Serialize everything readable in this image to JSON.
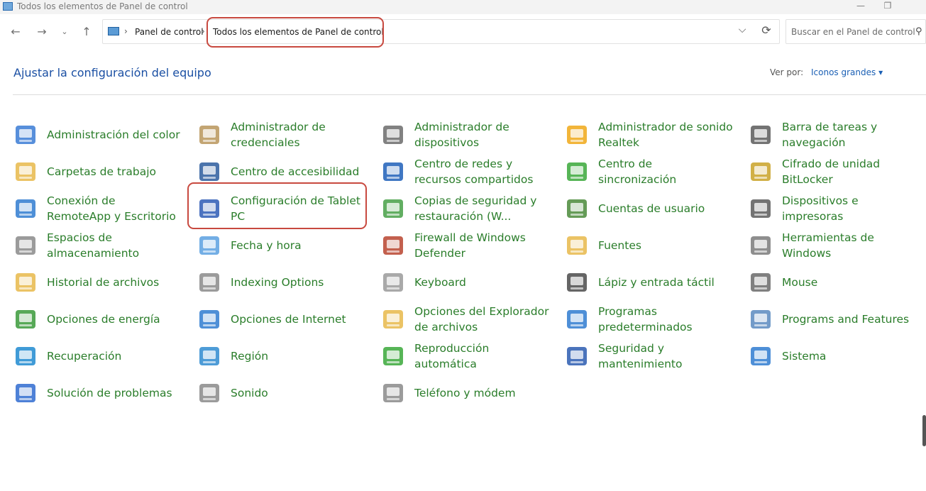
{
  "window": {
    "title": "Todos los elementos de Panel de control"
  },
  "address": {
    "crumbs": [
      "Panel de control",
      "Todos los elementos de Panel de control"
    ],
    "separator": "›"
  },
  "search": {
    "placeholder": "Buscar en el Panel de control"
  },
  "header": {
    "title": "Ajustar la configuración del equipo",
    "view_label": "Ver por:",
    "view_value": "Iconos grandes ▾"
  },
  "items": [
    {
      "label": "Administración del color",
      "icon": "color-management-icon",
      "color": "#3a7bd5"
    },
    {
      "label": "Administrador de credenciales",
      "icon": "credential-manager-icon",
      "color": "#b8955a"
    },
    {
      "label": "Administrador de dispositivos",
      "icon": "device-manager-icon",
      "color": "#6b6b6b"
    },
    {
      "label": "Administrador de sonido Realtek",
      "icon": "realtek-audio-icon",
      "color": "#f0a818"
    },
    {
      "label": "Barra de tareas y navegación",
      "icon": "taskbar-icon",
      "color": "#5a5a5a"
    },
    {
      "label": "Carpetas de trabajo",
      "icon": "work-folders-icon",
      "color": "#e8b84a"
    },
    {
      "label": "Centro de accesibilidad",
      "icon": "accessibility-icon",
      "color": "#2b5c9e"
    },
    {
      "label": "Centro de redes y recursos compartidos",
      "icon": "network-icon",
      "color": "#1f5fb8"
    },
    {
      "label": "Centro de sincronización",
      "icon": "sync-center-icon",
      "color": "#3aa83a"
    },
    {
      "label": "Cifrado de unidad BitLocker",
      "icon": "bitlocker-icon",
      "color": "#c9a227"
    },
    {
      "label": "Conexión de RemoteApp y Escritorio",
      "icon": "remoteapp-icon",
      "color": "#2f7bd0"
    },
    {
      "label": "Configuración de Tablet PC",
      "icon": "tablet-pc-icon",
      "color": "#2d5bb5"
    },
    {
      "label": "Copias de seguridad y restauración (W...",
      "icon": "backup-restore-icon",
      "color": "#47a047"
    },
    {
      "label": "Cuentas de usuario",
      "icon": "user-accounts-icon",
      "color": "#4a8a3a"
    },
    {
      "label": "Dispositivos e impresoras",
      "icon": "printer-icon",
      "color": "#5a5a5a"
    },
    {
      "label": "Espacios de almacenamiento",
      "icon": "storage-spaces-icon",
      "color": "#8a8a8a"
    },
    {
      "label": "Fecha y hora",
      "icon": "date-time-icon",
      "color": "#5aa0e0"
    },
    {
      "label": "Firewall de Windows Defender",
      "icon": "firewall-icon",
      "color": "#b8442f"
    },
    {
      "label": "Fuentes",
      "icon": "fonts-icon",
      "color": "#e8b84a"
    },
    {
      "label": "Herramientas de Windows",
      "icon": "windows-tools-icon",
      "color": "#7a7a7a"
    },
    {
      "label": "Historial de archivos",
      "icon": "file-history-icon",
      "color": "#e8b84a"
    },
    {
      "label": "Indexing Options",
      "icon": "indexing-options-icon",
      "color": "#8a8a8a"
    },
    {
      "label": "Keyboard",
      "icon": "keyboard-icon",
      "color": "#9a9a9a"
    },
    {
      "label": "Lápiz y entrada táctil",
      "icon": "pen-touch-icon",
      "color": "#4a4a4a"
    },
    {
      "label": "Mouse",
      "icon": "mouse-icon",
      "color": "#6a6a6a"
    },
    {
      "label": "Opciones de energía",
      "icon": "power-options-icon",
      "color": "#3a9a3a"
    },
    {
      "label": "Opciones de Internet",
      "icon": "internet-options-icon",
      "color": "#2f7bd0"
    },
    {
      "label": "Opciones del Explorador de archivos",
      "icon": "folder-options-icon",
      "color": "#e8b84a"
    },
    {
      "label": "Programas predeterminados",
      "icon": "default-programs-icon",
      "color": "#2f7bd0"
    },
    {
      "label": "Programs and Features",
      "icon": "programs-features-icon",
      "color": "#5a8ac0"
    },
    {
      "label": "Recuperación",
      "icon": "recovery-icon",
      "color": "#1f8ad0"
    },
    {
      "label": "Región",
      "icon": "region-icon",
      "color": "#2f8bd0"
    },
    {
      "label": "Reproducción automática",
      "icon": "autoplay-icon",
      "color": "#3aa83a"
    },
    {
      "label": "Seguridad y mantenimiento",
      "icon": "security-maintenance-icon",
      "color": "#2b5cb0"
    },
    {
      "label": "Sistema",
      "icon": "system-icon",
      "color": "#2f7bd0"
    },
    {
      "label": "Solución de problemas",
      "icon": "troubleshooting-icon",
      "color": "#2f6bd0"
    },
    {
      "label": "Sonido",
      "icon": "sound-icon",
      "color": "#8a8a8a"
    },
    {
      "label": "Teléfono y módem",
      "icon": "phone-modem-icon",
      "color": "#8a8a8a"
    }
  ]
}
